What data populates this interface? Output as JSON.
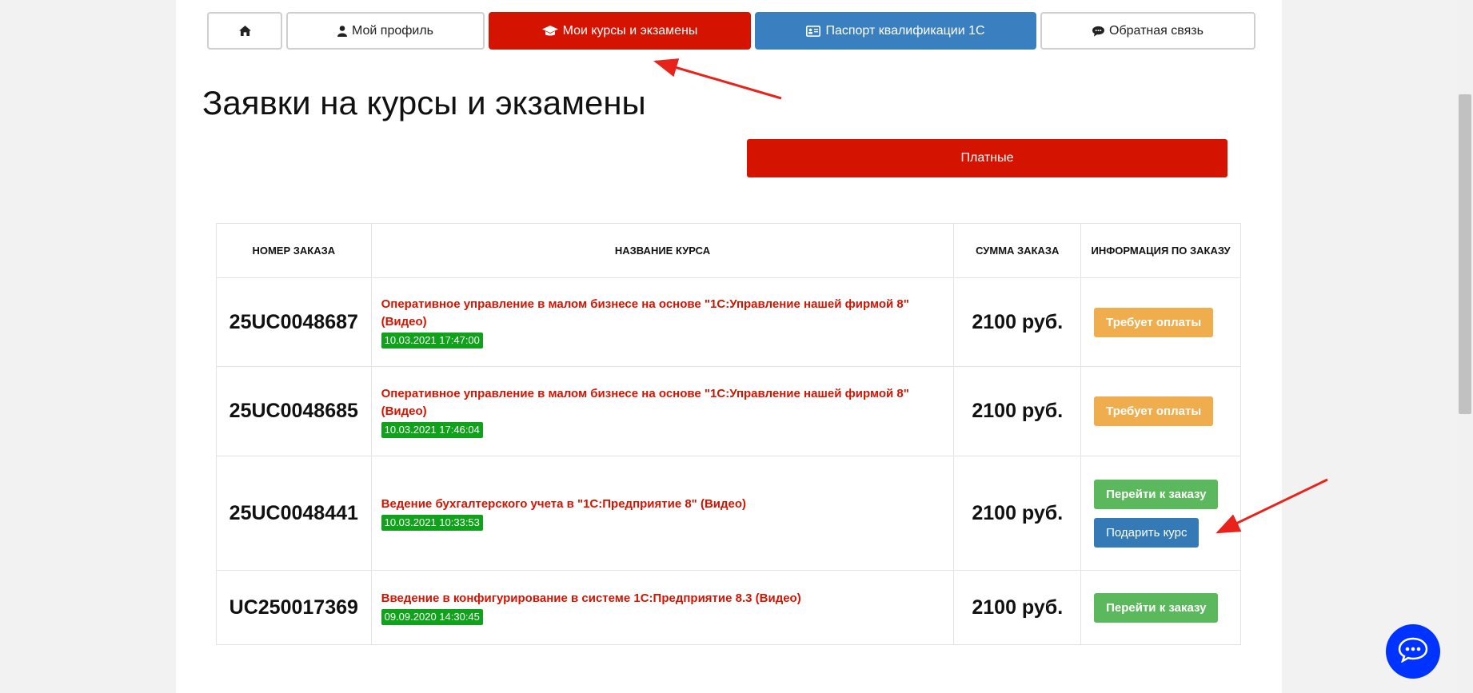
{
  "nav": {
    "home_icon": "home-icon",
    "profile_label": "Мой профиль",
    "courses_label": "Мои курсы и экзамены",
    "passport_label": "Паспорт квалификации 1С",
    "feedback_label": "Обратная связь"
  },
  "page_title": "Заявки на курсы и экзамены",
  "filter": {
    "paid_label": "Платные"
  },
  "table": {
    "headers": [
      "Номер заказа",
      "Название курса",
      "Сумма заказа",
      "Информация по заказу"
    ],
    "rows": [
      {
        "number": "25UC0048687",
        "title": "Оперативное управление в малом бизнесе на основе \"1С:Управление нашей фирмой 8\" (Видео)",
        "date": "10.03.2021 17:47:00",
        "sum": "2100 руб.",
        "action": "Требует оплаты"
      },
      {
        "number": "25UC0048685",
        "title": "Оперативное управление в малом бизнесе на основе \"1С:Управление нашей фирмой 8\" (Видео)",
        "date": "10.03.2021 17:46:04",
        "sum": "2100 руб.",
        "action": "Требует оплаты"
      },
      {
        "number": "25UC0048441",
        "title": "Ведение бухгалтерского учета в \"1С:Предприятие 8\" (Видео)",
        "date": "10.03.2021 10:33:53",
        "sum": "2100 руб.",
        "action": "Перейти к заказу",
        "action2": "Подарить курс"
      },
      {
        "number": "UC250017369",
        "title": "Введение в конфигурирование в системе 1С:Предприятие 8.3 (Видео)",
        "date": "09.09.2020 14:30:45",
        "sum": "2100 руб.",
        "action": "Перейти к заказу"
      }
    ]
  },
  "colors": {
    "accent_red": "#d41400",
    "accent_blue": "#3a7fc0",
    "date_green": "#10a21a",
    "pay_orange": "#f0ad4e",
    "go_green": "#5cb85c",
    "gift_blue": "#337ab7",
    "chat_blue": "#0033ff",
    "annotation_arrow": "#e8231c"
  },
  "chat_icon": "chat-bubble-icon"
}
